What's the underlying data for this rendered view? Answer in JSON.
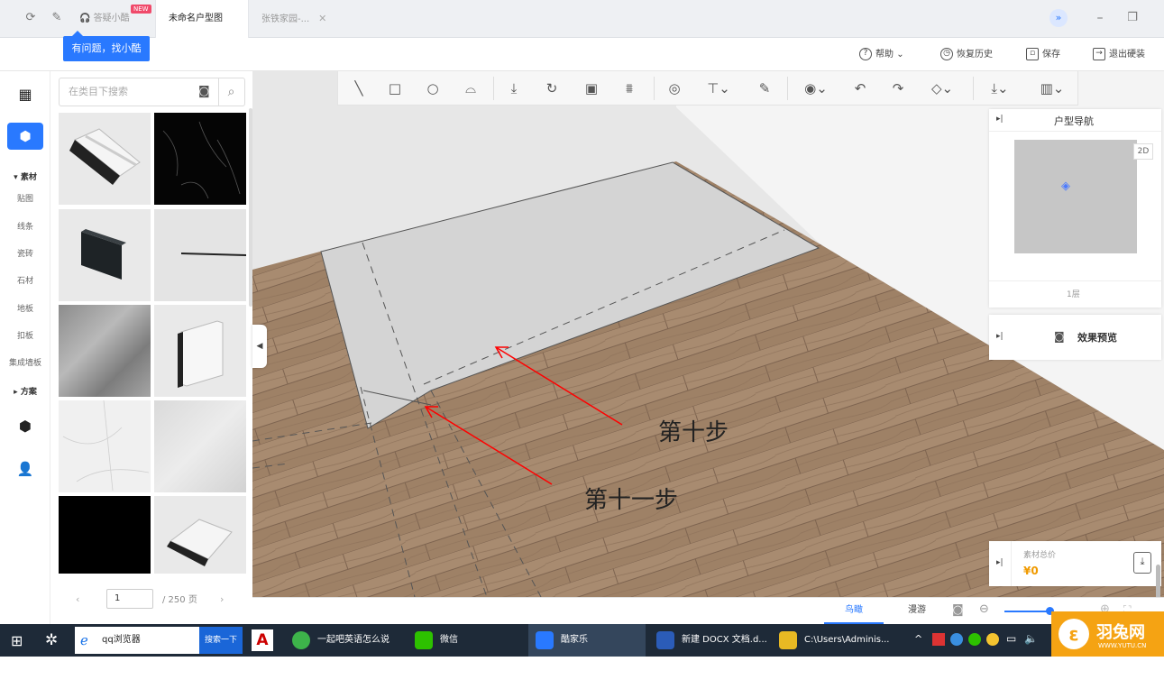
{
  "tabbar": {
    "tabs": [
      {
        "label": "答疑小酷",
        "badge": "NEW"
      },
      {
        "label": "未命名户型图",
        "active": true
      },
      {
        "label": "张铁家园-..."
      }
    ],
    "tooltip": "有问题，找小酷"
  },
  "header": {
    "help": "帮助",
    "history": "恢复历史",
    "save": "保存",
    "exit": "退出硬装"
  },
  "rail": {
    "sections": [
      {
        "label": "素材",
        "items": [
          "贴图",
          "线条",
          "瓷砖",
          "石材",
          "地板",
          "扣板",
          "集成墙板"
        ]
      },
      {
        "label": "方案"
      }
    ]
  },
  "panel": {
    "search_placeholder": "在类目下搜索",
    "page_current": "1",
    "page_total": "/ 250 页",
    "thumbs": [
      "crown-molding",
      "black-marble",
      "black-panel",
      "thin-line",
      "grey-stone",
      "baseboard",
      "white-marble",
      "grey-marble",
      "black-solid",
      "crown-molding-2"
    ]
  },
  "nav_panel": {
    "title": "户型导航",
    "mode": "2D",
    "floor": "1层"
  },
  "preview_panel": {
    "title": "效果预览"
  },
  "cost_panel": {
    "label": "素材总价",
    "value": "¥0"
  },
  "view_tabs": {
    "birdseye": "鸟瞰",
    "roam": "漫游"
  },
  "annotations": {
    "step10": "第十步",
    "step11": "第十一步"
  },
  "taskbar": {
    "search_text": "qq浏览器",
    "search_btn": "搜索一下",
    "apps": [
      "一起吧英语怎么说_...",
      "微信",
      "酷家乐",
      "新建 DOCX 文档.d...",
      "C:\\Users\\Adminis..."
    ],
    "watermark_cn": "羽兔网",
    "watermark_en": "WWW.YUTU.CN"
  },
  "colors": {
    "accent": "#2979ff",
    "price": "#f09a00",
    "annotation": "#ff0000"
  }
}
